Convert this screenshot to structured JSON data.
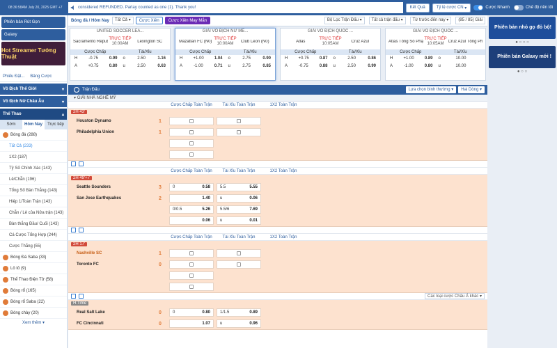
{
  "topbar": {
    "time": "08:36:58AM July 20, 2025 GMT +7",
    "message": "considered REFUNDED. Parlay counted as one (1). Thank you!",
    "ket_qua": "Kết Quả",
    "odds_type": "Tỷ lệ cược CN",
    "toggle_fast": "Cược Nhanh",
    "toggle_dark": "Chế độ nền tối"
  },
  "sidebar": {
    "btn_mobile": "Phiên bản Rút Gọn",
    "btn_galaxy": "Galaxy",
    "banner": "Hot Streamer Tướng Thuật",
    "tab_receipt": "Phiếu Đặt...",
    "tab_statement": "Bảng Cược",
    "cat_world": "Vô Địch Thế Giới",
    "cat_women_eu": "Vô Địch Nữ Châu Âu",
    "cat_sports": "Thể Thao",
    "sub_tabs": [
      "Sớm",
      "Hôm Nay",
      "Trực tiếp"
    ],
    "football": "Bóng đá (288)",
    "items": [
      "Tất Cả (233)",
      "1X2 (187)",
      "Tỷ Số Chính Xác (143)",
      "Lẻ/Chẵn (196)",
      "Tổng Số Bàn Thắng (143)",
      "Hiệp 1/Toàn Trận (143)",
      "Chẵn / Lẻ của Nửa trận (143)",
      "Bàn thắng Đầu/ Cuối (143)",
      "Cá Cược Tổng Hợp (244)",
      "Cược Thắng (55)"
    ],
    "others": [
      "Bóng Đá Saba (33)",
      "Lô tô (9)",
      "Thể Thao Điện Tử (58)",
      "Bóng rổ (165)",
      "Bóng rổ Saba (22)",
      "Bóng chày (20)"
    ],
    "more": "Xem thêm"
  },
  "filterbar": {
    "sport": "Bóng đá / Hôm Nay",
    "all": "Tất Cả",
    "btn_bet": "Cược Xiên",
    "btn_lucky": "Cược Xiên May Mắn",
    "league_filter": "Bộ Lọc Trận Đấu",
    "all_matches": "Tất cả trận đấu",
    "sort": "Từ trước đến nay",
    "count": "(85 / 85) Giải"
  },
  "cards": [
    {
      "league": "UNITED SOCCER LEA...",
      "home": "Sacramento Republic FC",
      "away": "Lexington SC",
      "status": "TRỰC TIẾP",
      "time": "10:00AM",
      "h": [
        "H",
        "-0.75",
        "0.99",
        "o",
        "2.50",
        "1.16"
      ],
      "a": [
        "A",
        "+0.75",
        "0.80",
        "u",
        "2.50",
        "0.63"
      ]
    },
    {
      "league": "GIẢI VÔ ĐỊCH NỮ ME...",
      "home": "Mazatlan FC (N0)",
      "away": "Club Leon (N0)",
      "status": "TRỰC TIẾP",
      "time": "10:00AM",
      "h": [
        "H",
        "+1.00",
        "1.04",
        "o",
        "2.75",
        "0.90"
      ],
      "a": [
        "A",
        "-1.00",
        "0.71",
        "u",
        "2.75",
        "0.85"
      ]
    },
    {
      "league": "GIẢI VÔ ĐỊCH QUỐC ...",
      "home": "Atlas",
      "away": "Cruz Azul",
      "status": "TRỰC TIẾP",
      "time": "10:05AM",
      "h": [
        "H",
        "+0.75",
        "0.87",
        "o",
        "2.50",
        "0.86"
      ],
      "a": [
        "A",
        "-0.75",
        "0.88",
        "u",
        "2.50",
        "0.99"
      ]
    },
    {
      "league": "GIẢI VÔ ĐỊCH QUỐC ...",
      "home": "Atlas Tổng Số Phạt Góc",
      "away": "Cruz Azul Tổng Phạt Góc",
      "status": "TRỰC TIẾP",
      "time": "10:05AM",
      "h": [
        "H",
        "+1.00",
        "0.89",
        "o",
        "10.00",
        ""
      ],
      "a": [
        "A",
        "-1.00",
        "0.80",
        "u",
        "10.00",
        ""
      ]
    }
  ],
  "card_headers": {
    "hdp": "Cược Chấp",
    "ou": "Tài/Xỉu"
  },
  "right": {
    "banner1": "Phiên bản nhỏ gọ đỏ bộ!",
    "banner2": "Phiên bản Galaxy mới !"
  },
  "main": {
    "header": "Trận Đấu",
    "sort_btn": "Lựa chọn bình thường",
    "lines_btn": "Hai Dòng",
    "league": "GIẢI NHÀ NGHỀ MỸ",
    "col_hdp": "Cược Chấp Toàn Trận",
    "col_ou": "Tài Xỉu Toàn Trận",
    "col_1x2": "1X2 Toàn Trận",
    "more_types": "Các loại cược Châu Á khác",
    "matches": [
      {
        "status": "2H 43'",
        "home": "Houston Dynamo",
        "away": "Philadelphia Union",
        "hs": "1",
        "as": "1",
        "rows": [
          [
            "lock",
            "lock"
          ],
          [
            "lock",
            "lock"
          ],
          [
            "lock",
            ""
          ],
          [
            "lock",
            ""
          ]
        ]
      },
      {
        "status": "2H 49'+7",
        "home": "Seattle Sounders",
        "away": "San Jose Earthquakes",
        "hs": "3",
        "as": "2",
        "rows": [
          [
            "0|0.58",
            "5.5|5.55"
          ],
          [
            "|1.40",
            "u|0.06"
          ],
          [
            "0/0.5|5.26",
            "5.5/6|7.69"
          ],
          [
            "|0.06",
            "u|0.01"
          ]
        ]
      },
      {
        "status": "2H 17'",
        "home": "Nashville SC",
        "away": "Toronto FC",
        "hs": "1",
        "as": "0",
        "rows": [
          [
            "lock",
            "lock"
          ],
          [
            "lock",
            "lock"
          ],
          [
            "lock",
            ""
          ],
          [
            "lock",
            ""
          ]
        ]
      },
      {
        "status": "H.Time",
        "home": "Real Salt Lake",
        "away": "FC Cincinnati",
        "hs": "0",
        "as": "0",
        "rows": [
          [
            "0|0.80",
            "1/1.5|0.89"
          ],
          [
            "|1.07",
            "u|0.96"
          ]
        ]
      }
    ]
  }
}
